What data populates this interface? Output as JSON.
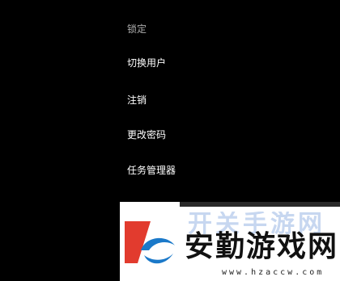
{
  "menu": {
    "items": [
      {
        "label": "锁定"
      },
      {
        "label": "切换用户"
      },
      {
        "label": "注销"
      },
      {
        "label": "更改密码"
      },
      {
        "label": "任务管理器"
      }
    ]
  },
  "watermark": {
    "faded_text": "开关手游网",
    "title": "安勤游戏网",
    "url": "www.hzaccw.com"
  },
  "colors": {
    "background": "#000000",
    "text": "#ffffff",
    "logo_red": "#e23b2e",
    "logo_blue": "#1b79c9"
  }
}
